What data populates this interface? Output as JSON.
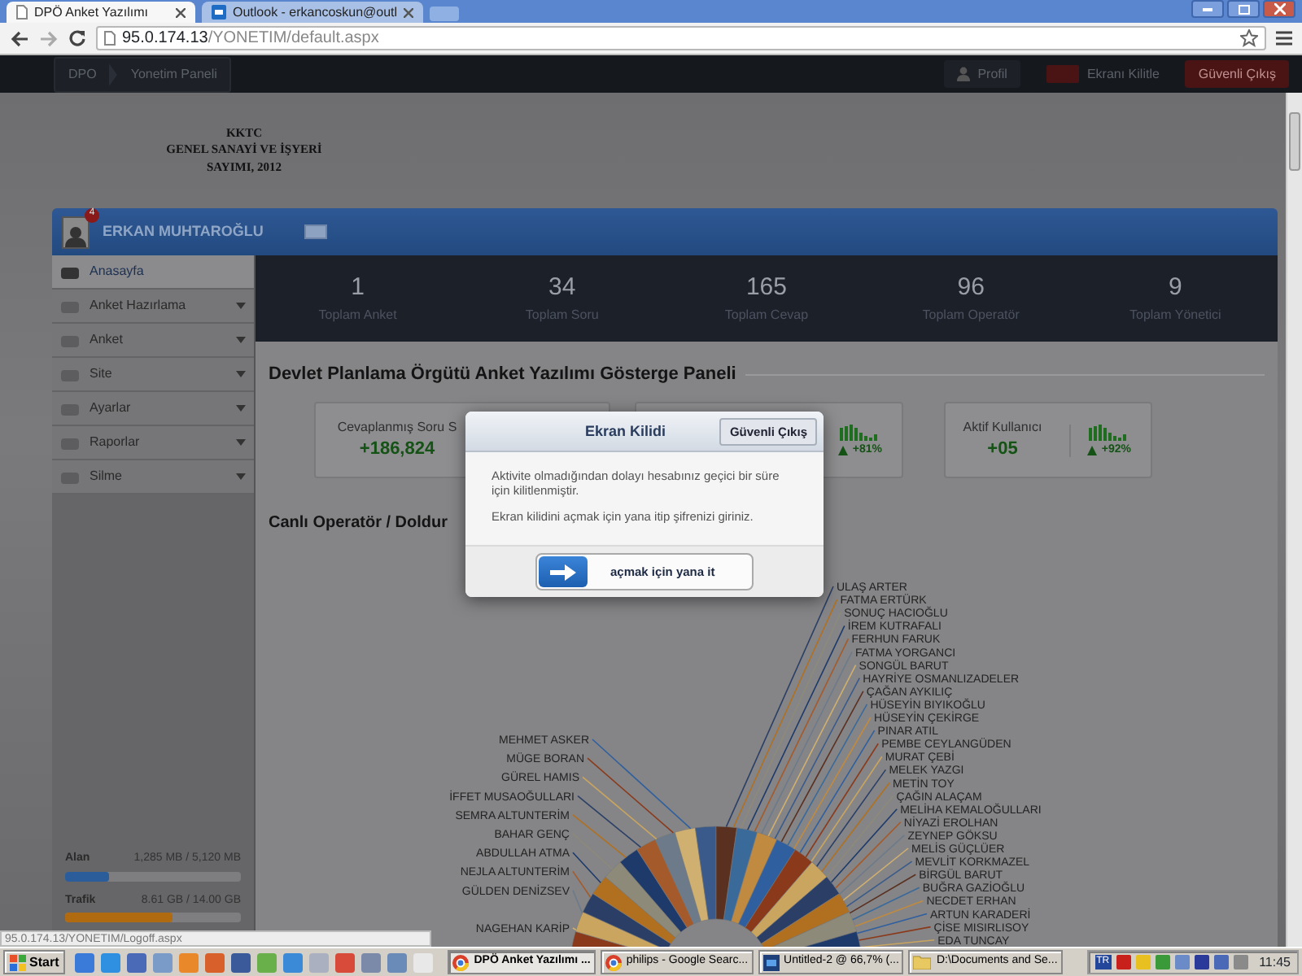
{
  "browser": {
    "tabs": [
      {
        "label": "DPÖ Anket Yazılımı",
        "kind": "page",
        "selected": true
      },
      {
        "label": "Outlook - erkancoskun@outl",
        "kind": "mail",
        "selected": false
      }
    ],
    "address": {
      "host": "95.0.174.13",
      "path": "/YONETIM/default.aspx"
    }
  },
  "topbar": {
    "breadcrumb": [
      "DPO",
      "Yonetim Paneli"
    ],
    "buttons": [
      {
        "label": "Profil",
        "kind": "profile"
      },
      {
        "label": "Ekranı Kilitle",
        "kind": "lock"
      },
      {
        "label": "Güvenli Çıkış",
        "kind": "logout"
      }
    ]
  },
  "header_lines": [
    "KKTC",
    "GENEL SANAYİ VE İŞYERİ",
    "SAYIMI, 2012"
  ],
  "user": {
    "name": "ERKAN MUHTAROĞLU",
    "badge": "4"
  },
  "sidebar": {
    "items": [
      {
        "label": "Anasayfa",
        "selected": true,
        "has_submenu": false
      },
      {
        "label": "Anket Hazırlama",
        "selected": false,
        "has_submenu": true
      },
      {
        "label": "Anket",
        "selected": false,
        "has_submenu": true
      },
      {
        "label": "Site",
        "selected": false,
        "has_submenu": true
      },
      {
        "label": "Ayarlar",
        "selected": false,
        "has_submenu": true
      },
      {
        "label": "Raporlar",
        "selected": false,
        "has_submenu": true
      },
      {
        "label": "Silme",
        "selected": false,
        "has_submenu": true
      }
    ],
    "usage": [
      {
        "label": "Alan",
        "reading": "1,285 MB / 5,120 MB",
        "level": 0.25,
        "color": "#2a5d9a"
      },
      {
        "label": "Trafik",
        "reading": "8.61 GB / 14.00 GB",
        "level": 0.61,
        "color": "#b06a10"
      }
    ]
  },
  "stats": [
    {
      "value": "1",
      "label": "Toplam Anket"
    },
    {
      "value": "34",
      "label": "Toplam Soru"
    },
    {
      "value": "165",
      "label": "Toplam Cevap"
    },
    {
      "value": "96",
      "label": "Toplam Operatör"
    },
    {
      "value": "9",
      "label": "Toplam Yönetici"
    }
  ],
  "dashboard_title": "Devlet Planlama Örgütü Anket Yazılımı Gösterge Paneli",
  "cards": [
    {
      "label": "Cevaplanmış Soru S",
      "value": "+186,824"
    },
    {
      "trend": "+81%"
    },
    {
      "label": "Aktif Kullanıcı",
      "value": "+05",
      "trend": "+92%"
    }
  ],
  "section_title": "Canlı Operatör / Doldur",
  "chart": {
    "labels_right": [
      "ULAŞ ARTER",
      "FATMA ERTÜRK",
      "SONUÇ HACIOĞLU",
      "İREM KUTRAFALI",
      "FERHUN FARUK",
      "FATMA YORGANCI",
      "SONGÜL BARUT",
      "HAYRİYE OSMANLIZADELER",
      "ÇAĞAN AYKILIÇ",
      "HÜSEYİN BIYIKOĞLU",
      "HÜSEYİN ÇEKİRGE",
      "PINAR ATIL",
      "PEMBE CEYLANGÜDEN",
      "MURAT ÇEBİ",
      "MELEK YAZGI",
      "METİN TOY",
      "ÇAĞIN ALAÇAM",
      "MELİHA KEMALOĞULLARI",
      "NİYAZİ EROLHAN",
      "ZEYNEP GÖKSU",
      "MELİS GÜÇLÜER",
      "MEVLİT KORKMAZEL",
      "BİRGÜL BARUT",
      "BUĞRA GAZİOĞLU",
      "NECDET ERHAN",
      "ARTUN KARADERİ",
      "ÇİSE MISIRLISOY",
      "EDA TUNCAY"
    ],
    "labels_left": [
      "MEHMET ASKER",
      "MÜGE BORAN",
      "GÜREL HAMIS",
      "İFFET MUSAOĞULLARI",
      "SEMRA ALTUNTERİM",
      "BAHAR GENÇ",
      "ABDULLAH ATMA",
      "NEJLA ALTUNTERİM",
      "GÜLDEN DENİZSEV",
      "NAGEHAN KARİP"
    ]
  },
  "modal": {
    "title": "Ekran Kilidi",
    "button": "Güvenli Çıkış",
    "paragraphs": [
      "Aktivite olmadığından dolayı hesabınız geçici bir süre için kilitlenmiştir.",
      "Ekran kilidini açmak için yana itip şifrenizi giriniz."
    ],
    "slider": {
      "label": "açmak için yana it",
      "level": 0
    }
  },
  "status_url": "95.0.174.13/YONETIM/Logoff.aspx",
  "taskbar": {
    "start": "Start",
    "tasks": [
      {
        "label": "DPÖ Anket Yazılımı ...",
        "kind": "browser",
        "selected": true
      },
      {
        "label": "philips - Google Searc...",
        "kind": "browser",
        "selected": false
      },
      {
        "label": "Untitled-2 @ 66,7% (...",
        "kind": "image",
        "selected": false
      },
      {
        "label": "D:\\Documents and Se...",
        "kind": "folder",
        "selected": false
      }
    ],
    "language": "TR",
    "clock": "11:45"
  }
}
